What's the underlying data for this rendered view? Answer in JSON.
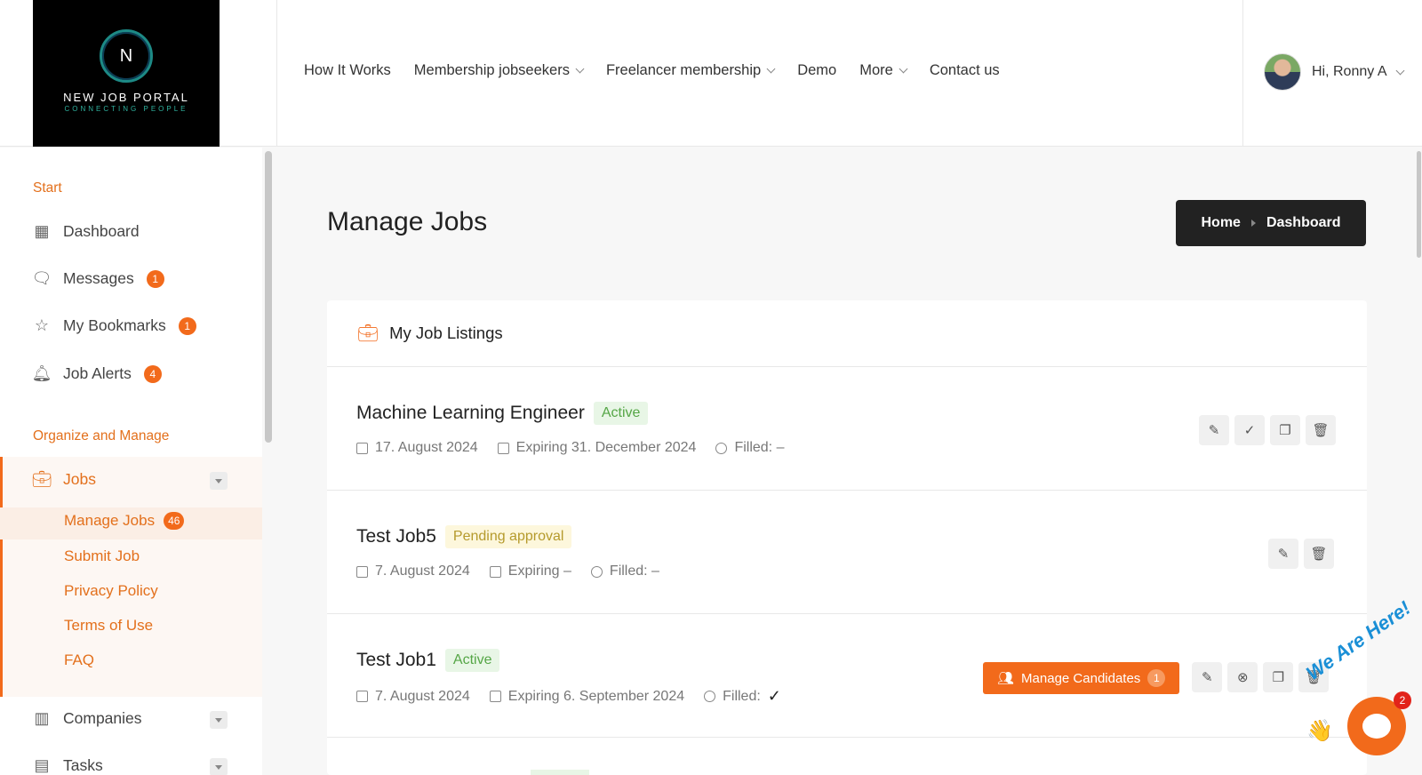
{
  "logo": {
    "letter": "N",
    "name": "NEW JOB PORTAL",
    "tagline": "CONNECTING PEOPLE"
  },
  "nav": {
    "items": [
      {
        "label": "How It Works",
        "dropdown": false
      },
      {
        "label": "Membership jobseekers",
        "dropdown": true
      },
      {
        "label": "Freelancer membership",
        "dropdown": true
      },
      {
        "label": "Demo",
        "dropdown": false
      },
      {
        "label": "More",
        "dropdown": true
      },
      {
        "label": "Contact us",
        "dropdown": false
      }
    ]
  },
  "user": {
    "greeting": "Hi, Ronny A"
  },
  "sidebar": {
    "section_start": "Start",
    "dashboard": "Dashboard",
    "messages": {
      "label": "Messages",
      "badge": "1"
    },
    "bookmarks": {
      "label": "My Bookmarks",
      "badge": "1"
    },
    "alerts": {
      "label": "Job Alerts",
      "badge": "4"
    },
    "section_organize": "Organize and Manage",
    "jobs": "Jobs",
    "sub": {
      "manage": {
        "label": "Manage Jobs",
        "badge": "46"
      },
      "submit": "Submit Job",
      "privacy": "Privacy Policy",
      "terms": "Terms of Use",
      "faq": "FAQ"
    },
    "companies": "Companies",
    "tasks": "Tasks"
  },
  "main": {
    "title": "Manage Jobs",
    "breadcrumb": {
      "home": "Home",
      "current": "Dashboard"
    },
    "card_title": "My Job Listings",
    "jobs": [
      {
        "title": "Machine Learning Engineer",
        "status": "Active",
        "date": "17. August 2024",
        "expiring": "Expiring 31. December 2024",
        "filled": "Filled: –"
      },
      {
        "title": "Test Job5",
        "status": "Pending approval",
        "date": "7. August 2024",
        "expiring": "Expiring –",
        "filled": "Filled: –"
      },
      {
        "title": "Test Job1",
        "status": "Active",
        "date": "7. August 2024",
        "expiring": "Expiring 6. September 2024",
        "filled": "Filled:",
        "filled_mark": "✓",
        "manage_candidates": "Manage Candidates",
        "candidates_count": "1"
      }
    ]
  },
  "chat": {
    "tagline": "We Are Here!",
    "badge": "2"
  },
  "colors": {
    "accent": "#f26a1b",
    "active": "#55a646",
    "pending": "#b59a2c",
    "breadcrumb_bg": "#222222"
  }
}
